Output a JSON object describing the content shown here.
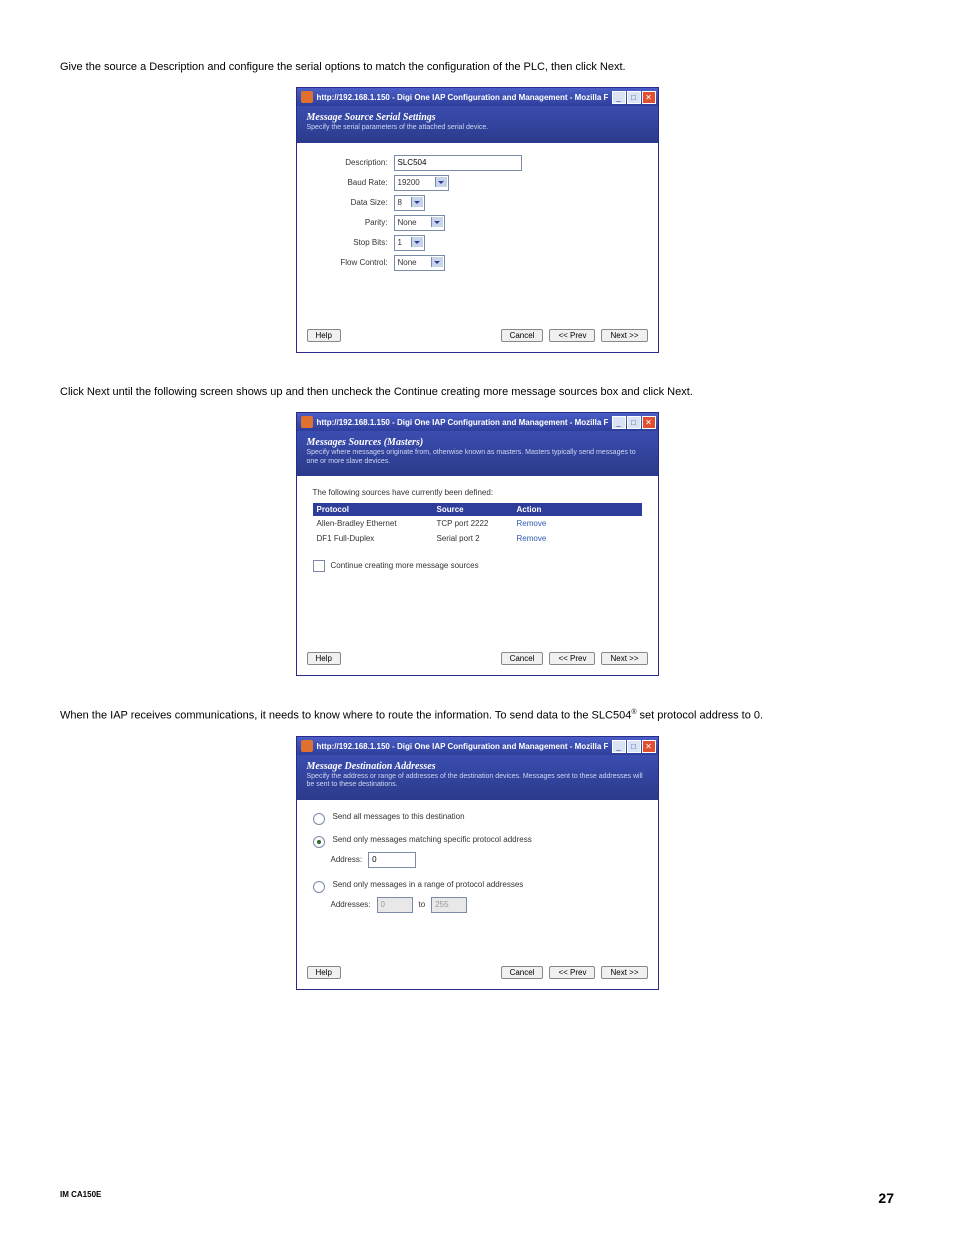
{
  "paragraphs": {
    "p1": "Give the source a Description and configure the serial options to match the configuration of the PLC, then click Next.",
    "p2": "Click Next until the following screen shows up and then uncheck the Continue creating more message sources box and click Next.",
    "p3a": "When the IAP receives communications, it needs to know where to route the information.  To send data to the SLC504",
    "p3b": " set protocol address to 0."
  },
  "titlebar": {
    "text": "http://192.168.1.150 - Digi One IAP Configuration and Management - Mozilla F...",
    "min": "_",
    "max": "□",
    "close": "✕"
  },
  "dialog1": {
    "title": "Message Source Serial Settings",
    "subtitle": "Specify the serial parameters of the attached serial device.",
    "labels": {
      "description": "Description:",
      "baud": "Baud Rate:",
      "datasize": "Data Size:",
      "parity": "Parity:",
      "stopbits": "Stop Bits:",
      "flow": "Flow Control:"
    },
    "values": {
      "description": "SLC504",
      "baud": "19200",
      "datasize": "8",
      "parity": "None",
      "stopbits": "1",
      "flow": "None"
    }
  },
  "dialog2": {
    "title": "Messages Sources (Masters)",
    "subtitle": "Specify where messages originate from, otherwise known as masters. Masters typically send messages to one or more slave devices.",
    "intro": "The following sources have currently been defined:",
    "headers": {
      "protocol": "Protocol",
      "source": "Source",
      "action": "Action"
    },
    "rows": [
      {
        "protocol": "Allen-Bradley Ethernet",
        "source": "TCP port 2222",
        "action": "Remove"
      },
      {
        "protocol": "DF1 Full-Duplex",
        "source": "Serial port 2",
        "action": "Remove"
      }
    ],
    "checkbox": "Continue creating more message sources"
  },
  "dialog3": {
    "title": "Message Destination Addresses",
    "subtitle": "Specify the address or range of addresses of the destination devices. Messages sent to these addresses will be sent to these destinations.",
    "opt1": "Send all messages to this destination",
    "opt2": "Send only messages matching specific protocol address",
    "opt2_label": "Address:",
    "opt2_value": "0",
    "opt3": "Send only messages in a range of protocol addresses",
    "opt3_label": "Addresses:",
    "opt3_from": "0",
    "opt3_to_label": "to",
    "opt3_to": "255"
  },
  "buttons": {
    "help": "Help",
    "cancel": "Cancel",
    "prev": "<< Prev",
    "next": "Next >>"
  },
  "footer": {
    "doc": "IM CA150E",
    "page": "27"
  },
  "reg": "®"
}
